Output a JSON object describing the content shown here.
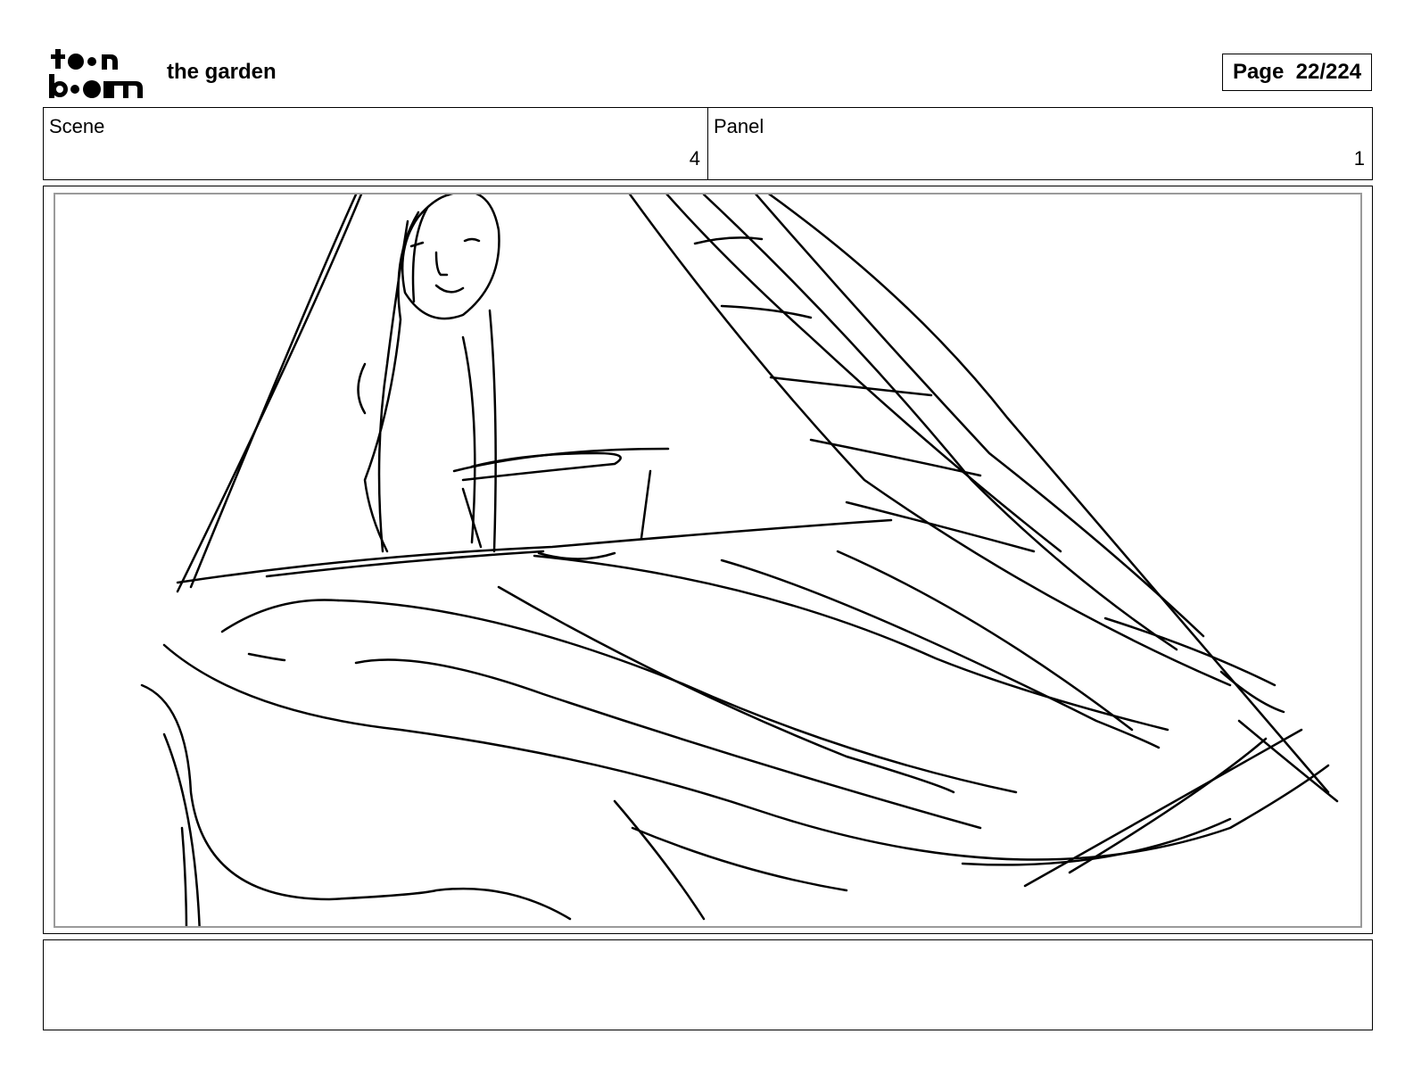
{
  "header": {
    "logo": {
      "line1": "toon",
      "line2": "boom"
    },
    "project_title": "the garden",
    "page_label": "Page  22/224"
  },
  "info": {
    "scene_label": "Scene",
    "scene_value": "4",
    "panel_label": "Panel",
    "panel_value": "1"
  },
  "notes": {
    "text": ""
  }
}
